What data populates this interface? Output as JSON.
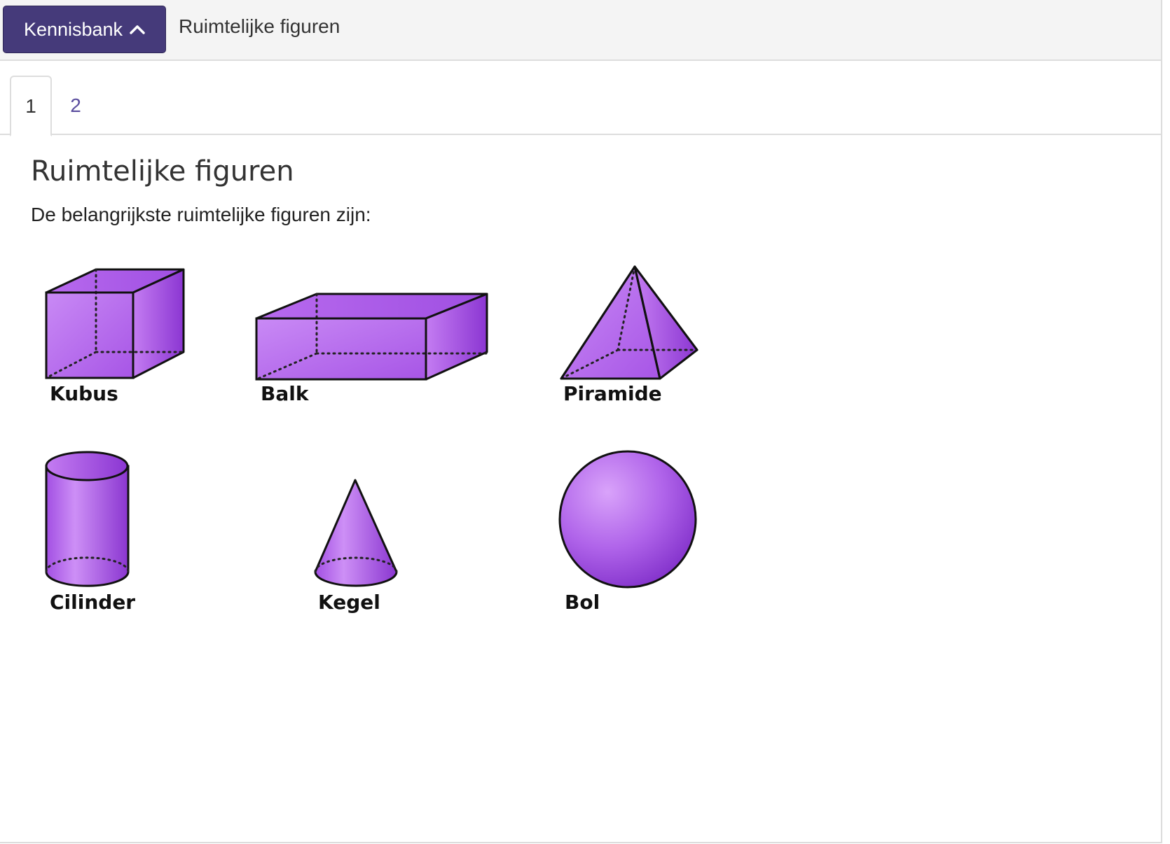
{
  "header": {
    "kb_button_label": "Kennisbank",
    "title": "Ruimtelijke figuren"
  },
  "tabs": [
    {
      "label": "1",
      "active": true
    },
    {
      "label": "2",
      "active": false
    }
  ],
  "content": {
    "title": "Ruimtelijke figuren",
    "intro": "De belangrijkste ruimtelijke figuren zijn:"
  },
  "shapes": {
    "cube": "Kubus",
    "cuboid": "Balk",
    "pyramid": "Piramide",
    "cylinder": "Cilinder",
    "cone": "Kegel",
    "sphere": "Bol"
  },
  "colors": {
    "accent": "#453a7a",
    "link": "#5a4d9e",
    "shape_fill": "#b56ae8",
    "shape_dark": "#8a3ad0"
  }
}
